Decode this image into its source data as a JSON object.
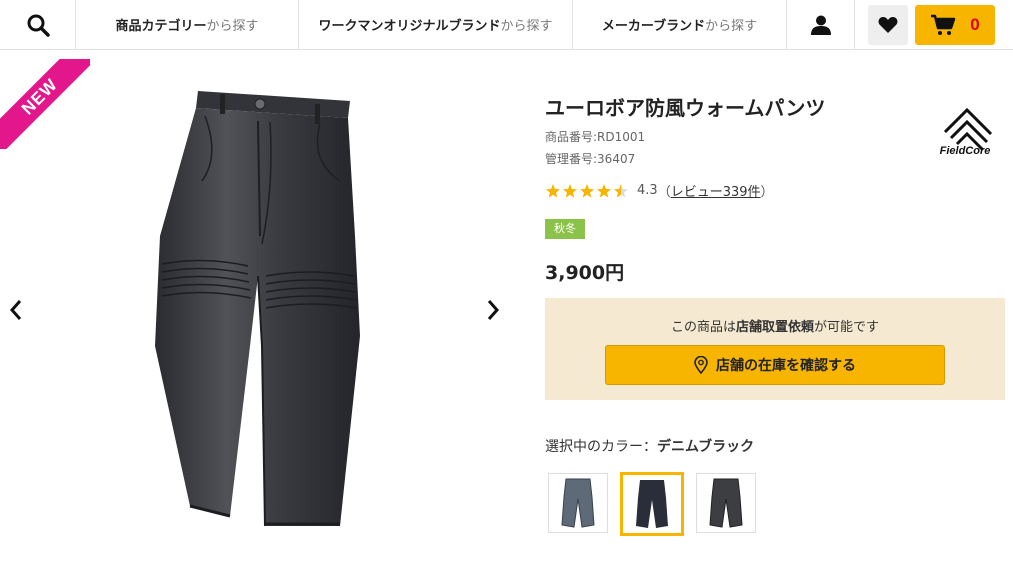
{
  "header": {
    "nav": [
      {
        "main": "商品カテゴリー",
        "suffix": "から探す"
      },
      {
        "main": "ワークマンオリジナルブランド",
        "suffix": "から探す"
      },
      {
        "main": "メーカーブランド",
        "suffix": "から探す"
      }
    ],
    "cart_count": "0",
    "icons": [
      "search-icon",
      "user-icon",
      "heart-icon",
      "cart-icon"
    ]
  },
  "gallery": {
    "ribbon": "NEW"
  },
  "product": {
    "title": "ユーロボア防風ウォームパンツ",
    "product_number": "商品番号:RD1001",
    "management_number": "管理番号:36407",
    "brand": "FieldCore",
    "rating": "4.3",
    "rating_stars": 4.5,
    "review_link": "レビュー339件",
    "season": "秋冬",
    "price": "3,900円"
  },
  "store": {
    "msg_prefix": "この商品は",
    "msg_bold": "店舗取置依頼",
    "msg_suffix": "が可能です",
    "button": "店舗の在庫を確認する"
  },
  "color": {
    "label": "選択中のカラー：",
    "selected": "デニムブラック",
    "swatch_count_selected_index": 1
  },
  "colors": {
    "accent": "#f7b500",
    "ribbon": "#e4168c",
    "season": "#8bc34a",
    "cart_count": "#e60012"
  }
}
